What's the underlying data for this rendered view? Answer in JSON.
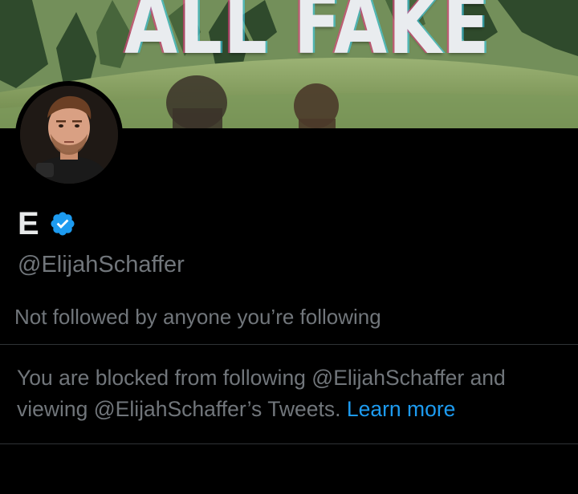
{
  "banner": {
    "overlay_text": "ALL FAKE"
  },
  "profile": {
    "display_name": "E",
    "verified": true,
    "handle": "@ElijahSchaffer",
    "followers_context": "Not followed by anyone you’re following"
  },
  "blocked_notice": {
    "text": "You are blocked from following @ElijahSchaffer and viewing @ElijahSchaffer’s Tweets.",
    "learn_more_label": "Learn more"
  },
  "colors": {
    "background": "#000000",
    "primary_text": "#e7e9ea",
    "secondary_text": "#71767b",
    "accent": "#1d9bf0",
    "divider": "#2f3336",
    "verified_badge": "#1d9bf0"
  },
  "icons": {
    "verified": "verified-badge-icon"
  }
}
